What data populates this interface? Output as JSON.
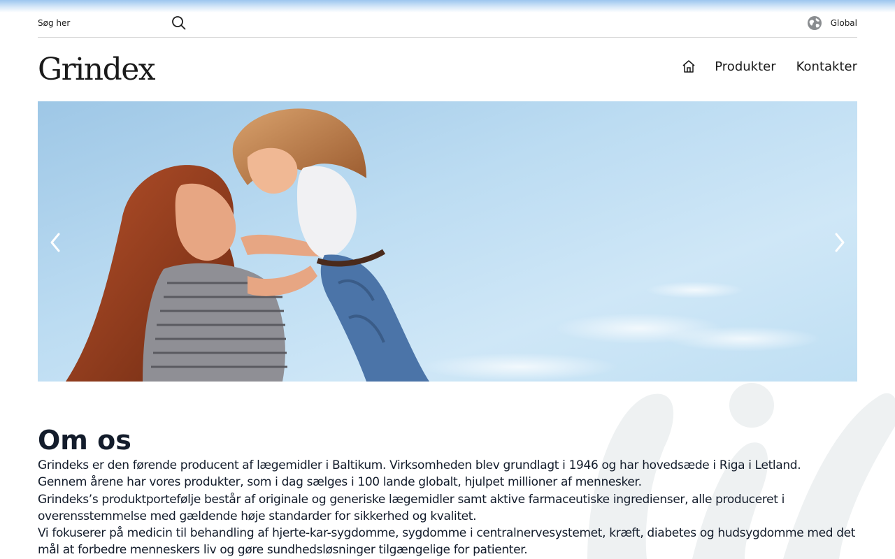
{
  "search": {
    "placeholder": "Søg her"
  },
  "region": {
    "label": "Global",
    "icon": "globe-icon"
  },
  "header": {
    "logo": "Grindex",
    "nav": {
      "home_icon": "home-icon",
      "products": "Produkter",
      "contacts": "Kontakter"
    }
  },
  "hero": {
    "prev_icon": "chevron-left-icon",
    "next_icon": "chevron-right-icon"
  },
  "about": {
    "title": "Om os",
    "paragraphs": [
      "Grindeks er den førende producent af lægemidler i Baltikum. Virksomheden blev grundlagt i 1946 og har hovedsæde i Riga i Letland.",
      "Gennem årene har vores produkter, som i dag sælges i 100 lande globalt, hjulpet millioner af mennesker.",
      "Grindeks’s produktportefølje består af originale og generiske lægemidler samt aktive farmaceutiske ingredienser, alle produceret i overensstemmelse med gældende høje standarder for sikkerhed og kvalitet.",
      "Vi fokuserer på medicin til behandling af hjerte-kar-sygdomme, sygdomme i centralnervesystemet, kræft, diabetes og hudsygdomme med det mål at forbedre menneskers liv og gøre sundhedsløsninger tilgængelige for patienter."
    ]
  },
  "colors": {
    "text": "#131c2b",
    "divider": "#d9d9d9",
    "watermark": "#eef1f2"
  }
}
